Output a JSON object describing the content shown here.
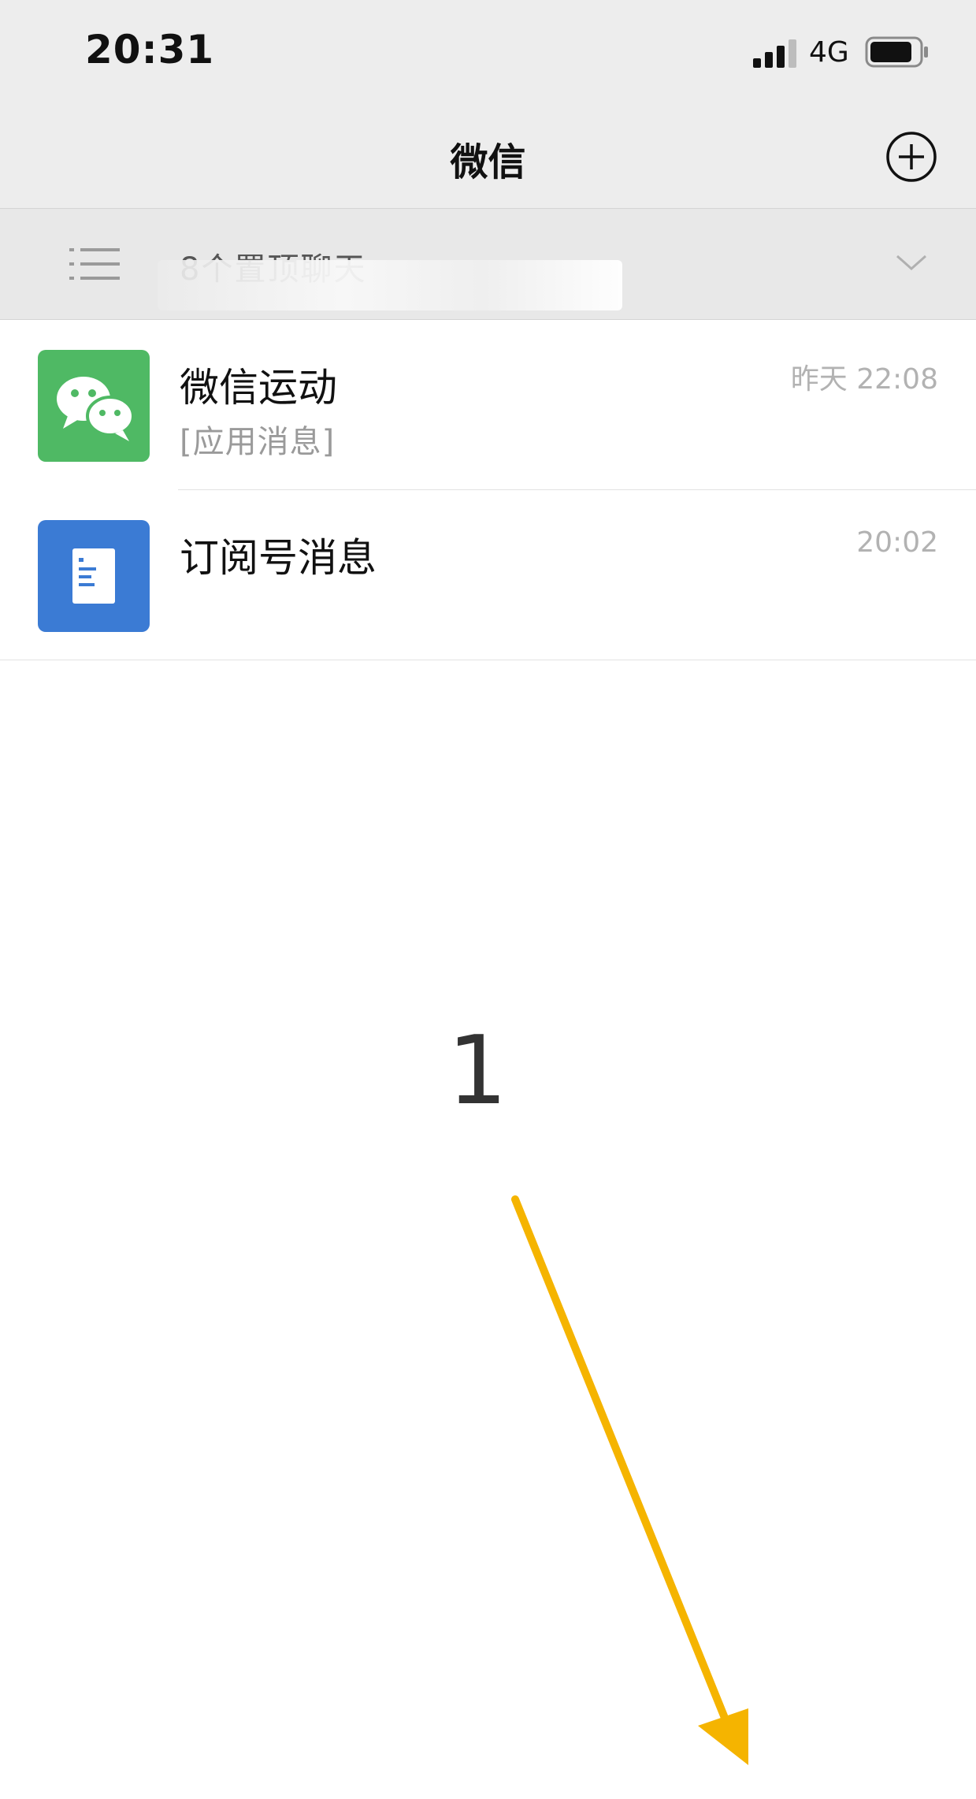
{
  "status_bar": {
    "time": "20:31",
    "network": "4G",
    "icons": [
      "signal-icon",
      "battery-icon"
    ]
  },
  "nav": {
    "title": "微信",
    "add_icon": "plus-circle-icon"
  },
  "pinned": {
    "label": "8个置顶聊天",
    "icon": "list-icon",
    "expand_icon": "chevron-down-icon"
  },
  "chats": [
    {
      "name": "微信运动",
      "time": "昨天 22:08",
      "preview": "[应用消息]",
      "avatar_icon": "wechat-bubbles-icon",
      "avatar_color": "#4fb964"
    },
    {
      "name": "订阅号消息",
      "time": "20:02",
      "preview": "",
      "avatar_icon": "document-icon",
      "avatar_color": "#3b7bd4"
    }
  ],
  "annotation": {
    "step": "1",
    "arrow_color": "#f5b400"
  }
}
